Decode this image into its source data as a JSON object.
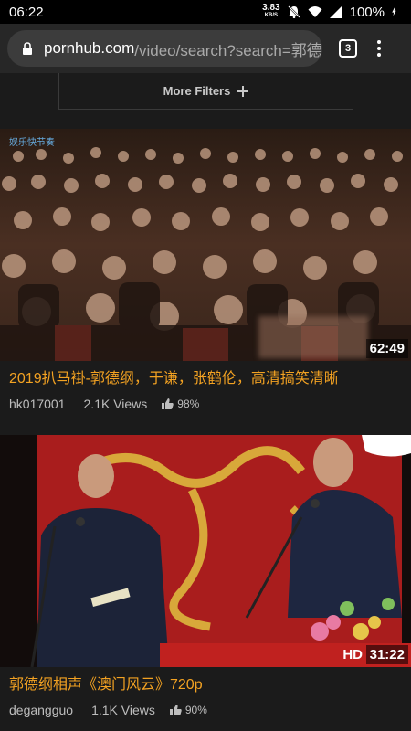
{
  "status_bar": {
    "time": "06:22",
    "net_speed_value": "3.83",
    "net_speed_unit": "KB/S",
    "battery": "100%"
  },
  "browser": {
    "url_host": "pornhub.com",
    "url_path": "/video/search?search=郭德",
    "tab_count": "3"
  },
  "filters": {
    "label": "More Filters"
  },
  "videos": [
    {
      "title": "2019扒马褂-郭德纲，于谦，张鹤伦，高清搞笑清晰",
      "uploader": "hk017001",
      "views": "2.1K Views",
      "rating": "98%",
      "duration": "62:49",
      "watermark": "娱乐快节奏"
    },
    {
      "title": "郭德纲相声《澳门风云》720p",
      "uploader": "degangguo",
      "views": "1.1K Views",
      "rating": "90%",
      "duration": "31:22",
      "badge": "HD"
    }
  ],
  "colors": {
    "accent": "#f3a222",
    "background": "#1b1b1b"
  }
}
